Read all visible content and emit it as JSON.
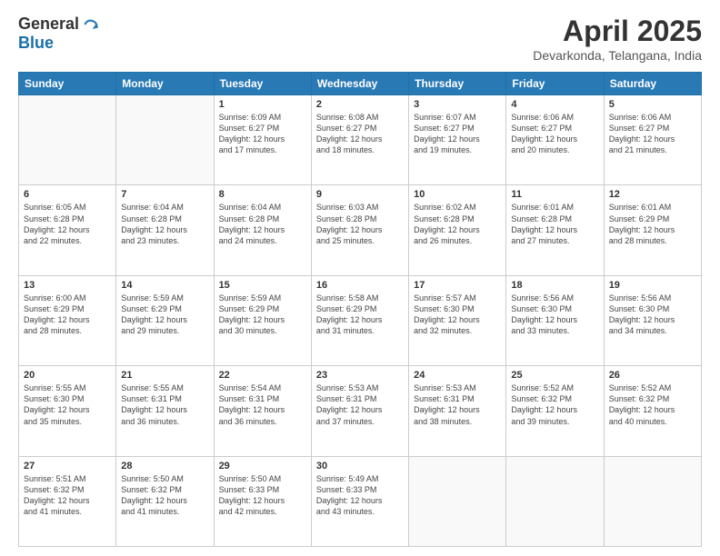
{
  "header": {
    "logo_general": "General",
    "logo_blue": "Blue",
    "title": "April 2025",
    "location": "Devarkonda, Telangana, India"
  },
  "days_of_week": [
    "Sunday",
    "Monday",
    "Tuesday",
    "Wednesday",
    "Thursday",
    "Friday",
    "Saturday"
  ],
  "weeks": [
    [
      {
        "num": "",
        "info": ""
      },
      {
        "num": "",
        "info": ""
      },
      {
        "num": "1",
        "info": "Sunrise: 6:09 AM\nSunset: 6:27 PM\nDaylight: 12 hours\nand 17 minutes."
      },
      {
        "num": "2",
        "info": "Sunrise: 6:08 AM\nSunset: 6:27 PM\nDaylight: 12 hours\nand 18 minutes."
      },
      {
        "num": "3",
        "info": "Sunrise: 6:07 AM\nSunset: 6:27 PM\nDaylight: 12 hours\nand 19 minutes."
      },
      {
        "num": "4",
        "info": "Sunrise: 6:06 AM\nSunset: 6:27 PM\nDaylight: 12 hours\nand 20 minutes."
      },
      {
        "num": "5",
        "info": "Sunrise: 6:06 AM\nSunset: 6:27 PM\nDaylight: 12 hours\nand 21 minutes."
      }
    ],
    [
      {
        "num": "6",
        "info": "Sunrise: 6:05 AM\nSunset: 6:28 PM\nDaylight: 12 hours\nand 22 minutes."
      },
      {
        "num": "7",
        "info": "Sunrise: 6:04 AM\nSunset: 6:28 PM\nDaylight: 12 hours\nand 23 minutes."
      },
      {
        "num": "8",
        "info": "Sunrise: 6:04 AM\nSunset: 6:28 PM\nDaylight: 12 hours\nand 24 minutes."
      },
      {
        "num": "9",
        "info": "Sunrise: 6:03 AM\nSunset: 6:28 PM\nDaylight: 12 hours\nand 25 minutes."
      },
      {
        "num": "10",
        "info": "Sunrise: 6:02 AM\nSunset: 6:28 PM\nDaylight: 12 hours\nand 26 minutes."
      },
      {
        "num": "11",
        "info": "Sunrise: 6:01 AM\nSunset: 6:28 PM\nDaylight: 12 hours\nand 27 minutes."
      },
      {
        "num": "12",
        "info": "Sunrise: 6:01 AM\nSunset: 6:29 PM\nDaylight: 12 hours\nand 28 minutes."
      }
    ],
    [
      {
        "num": "13",
        "info": "Sunrise: 6:00 AM\nSunset: 6:29 PM\nDaylight: 12 hours\nand 28 minutes."
      },
      {
        "num": "14",
        "info": "Sunrise: 5:59 AM\nSunset: 6:29 PM\nDaylight: 12 hours\nand 29 minutes."
      },
      {
        "num": "15",
        "info": "Sunrise: 5:59 AM\nSunset: 6:29 PM\nDaylight: 12 hours\nand 30 minutes."
      },
      {
        "num": "16",
        "info": "Sunrise: 5:58 AM\nSunset: 6:29 PM\nDaylight: 12 hours\nand 31 minutes."
      },
      {
        "num": "17",
        "info": "Sunrise: 5:57 AM\nSunset: 6:30 PM\nDaylight: 12 hours\nand 32 minutes."
      },
      {
        "num": "18",
        "info": "Sunrise: 5:56 AM\nSunset: 6:30 PM\nDaylight: 12 hours\nand 33 minutes."
      },
      {
        "num": "19",
        "info": "Sunrise: 5:56 AM\nSunset: 6:30 PM\nDaylight: 12 hours\nand 34 minutes."
      }
    ],
    [
      {
        "num": "20",
        "info": "Sunrise: 5:55 AM\nSunset: 6:30 PM\nDaylight: 12 hours\nand 35 minutes."
      },
      {
        "num": "21",
        "info": "Sunrise: 5:55 AM\nSunset: 6:31 PM\nDaylight: 12 hours\nand 36 minutes."
      },
      {
        "num": "22",
        "info": "Sunrise: 5:54 AM\nSunset: 6:31 PM\nDaylight: 12 hours\nand 36 minutes."
      },
      {
        "num": "23",
        "info": "Sunrise: 5:53 AM\nSunset: 6:31 PM\nDaylight: 12 hours\nand 37 minutes."
      },
      {
        "num": "24",
        "info": "Sunrise: 5:53 AM\nSunset: 6:31 PM\nDaylight: 12 hours\nand 38 minutes."
      },
      {
        "num": "25",
        "info": "Sunrise: 5:52 AM\nSunset: 6:32 PM\nDaylight: 12 hours\nand 39 minutes."
      },
      {
        "num": "26",
        "info": "Sunrise: 5:52 AM\nSunset: 6:32 PM\nDaylight: 12 hours\nand 40 minutes."
      }
    ],
    [
      {
        "num": "27",
        "info": "Sunrise: 5:51 AM\nSunset: 6:32 PM\nDaylight: 12 hours\nand 41 minutes."
      },
      {
        "num": "28",
        "info": "Sunrise: 5:50 AM\nSunset: 6:32 PM\nDaylight: 12 hours\nand 41 minutes."
      },
      {
        "num": "29",
        "info": "Sunrise: 5:50 AM\nSunset: 6:33 PM\nDaylight: 12 hours\nand 42 minutes."
      },
      {
        "num": "30",
        "info": "Sunrise: 5:49 AM\nSunset: 6:33 PM\nDaylight: 12 hours\nand 43 minutes."
      },
      {
        "num": "",
        "info": ""
      },
      {
        "num": "",
        "info": ""
      },
      {
        "num": "",
        "info": ""
      }
    ]
  ]
}
